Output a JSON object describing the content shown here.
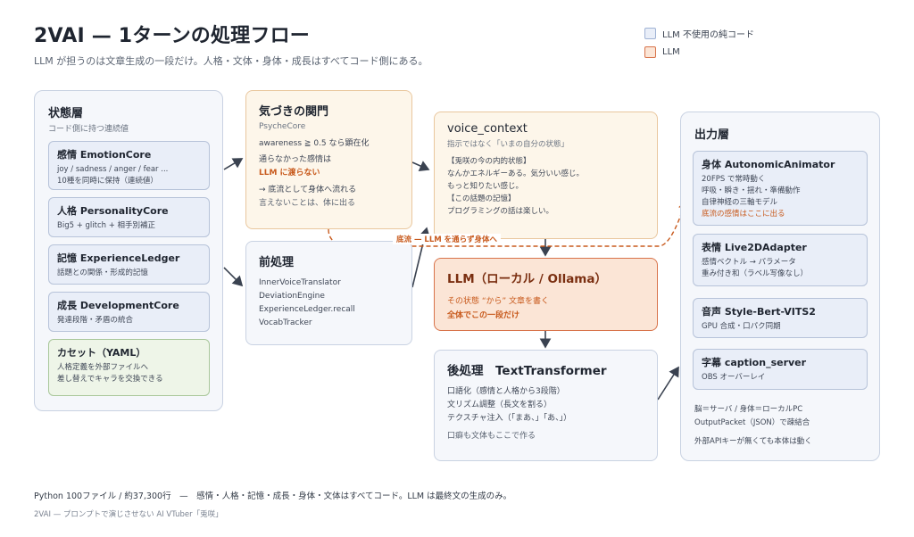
{
  "header": {
    "title": "2VAI — 1ターンの処理フロー",
    "subtitle": "LLM が担うのは文章生成の一段だけ。人格・文体・身体・成長はすべてコード側にある。"
  },
  "legend": {
    "non_llm": "LLM 不使用の純コード",
    "llm": "LLM"
  },
  "state_layer": {
    "title": "状態層",
    "subtitle": "コード側に持つ連続値",
    "cards": [
      {
        "title": "感情 EmotionCore",
        "lines": [
          "joy / sadness / anger / fear ...",
          "10種を同時に保持（連続値）"
        ]
      },
      {
        "title": "人格 PersonalityCore",
        "lines": [
          "Big5 + glitch + 相手別補正"
        ]
      },
      {
        "title": "記憶 ExperienceLedger",
        "lines": [
          "話題との関係・形成的記憶"
        ]
      },
      {
        "title": "成長 DevelopmentCore",
        "lines": [
          "発達段階・矛盾の統合"
        ]
      },
      {
        "title": "カセット（YAML）",
        "lines": [
          "人格定義を外部ファイルへ",
          "差し替えでキャラを交換できる"
        ]
      }
    ]
  },
  "awareness": {
    "title": "気づきの関門",
    "subtitle": "PsycheCore",
    "line1": "awareness ≧ 0.5 なら顕在化",
    "line2": "通らなかった感情は",
    "line3": "LLM に渡らない",
    "line4": "→ 底流として身体へ流れる",
    "line5": "言えないことは、体に出る"
  },
  "preprocess": {
    "title": "前処理",
    "lines": [
      "InnerVoiceTranslator",
      "DeviationEngine",
      "ExperienceLedger.recall",
      "VocabTracker"
    ]
  },
  "voice_context": {
    "title": "voice_context",
    "subtitle": "指示ではなく「いまの自分の状態」",
    "lines": [
      "【兎咲の今の内的状態】",
      "なんかエネルギーある。気分いい感じ。",
      "もっと知りたい感じ。",
      "【この話題の記憶】",
      "プログラミングの話は楽しい。"
    ]
  },
  "llm_core": {
    "title": "LLM（ローカル / Ollama）",
    "line1": "その状態 “から” 文章を書く",
    "line2": "全体でこの一段だけ"
  },
  "postprocess": {
    "title": "後処理　TextTransformer",
    "lines": [
      "口語化（感情と人格から3段階）",
      "文リズム調整（長文を割る）",
      "テクスチャ注入（「まあ、」「あ、」）"
    ],
    "note": "口癖も文体もここで作る"
  },
  "undercurrent_label": "底流 — LLM を通らず身体へ",
  "output_layer": {
    "title": "出力層",
    "cards": [
      {
        "title": "身体 AutonomicAnimator",
        "lines": [
          "20FPS で常時動く",
          "呼吸・瞬き・揺れ・準備動作",
          "自律神経の三軸モデル"
        ],
        "highlight": "底流の感情はここに出る"
      },
      {
        "title": "表情 Live2DAdapter",
        "lines": [
          "感情ベクトル → パラメータ",
          "重み付き和（ラベル写像なし）"
        ]
      },
      {
        "title": "音声 Style-Bert-VITS2",
        "lines": [
          "GPU 合成・口パク同期"
        ]
      },
      {
        "title": "字幕 caption_server",
        "lines": [
          "OBS オーバーレイ"
        ]
      }
    ],
    "notes": [
      "脳＝サーバ / 身体＝ローカルPC",
      "OutputPacket（JSON）で疎結合",
      "外部APIキーが無くても本体は動く"
    ]
  },
  "footer": {
    "line1": "Python 100ファイル / 約37,300行　—　感情・人格・記憶・成長・身体・文体はすべてコード。LLM は最終文の生成のみ。",
    "line2": "2VAI — プロンプトで演じさせない AI VTuber「兎咲」"
  },
  "colors": {
    "code_fill": "#e9eef8",
    "code_border": "#9fb2d4",
    "llm_fill": "#fbe5d6",
    "llm_border": "#d8734a",
    "accent": "#c85a1d"
  }
}
